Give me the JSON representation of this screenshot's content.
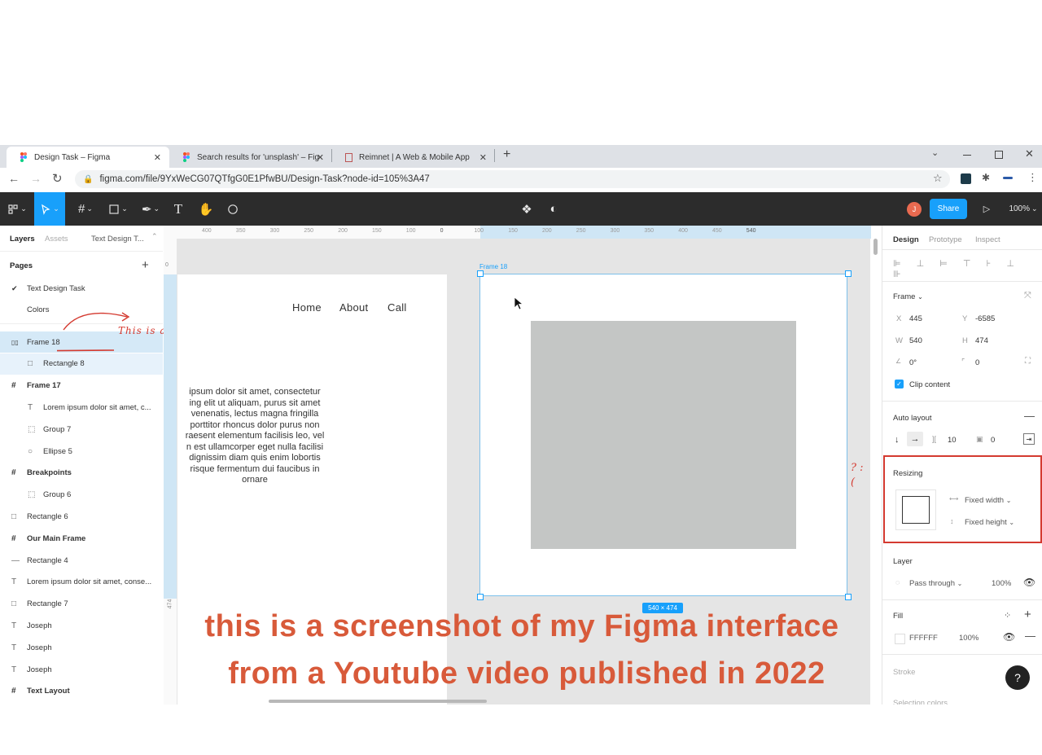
{
  "browser": {
    "tabs": [
      {
        "title": "Design Task – Figma"
      },
      {
        "title": "Search results for 'unsplash' – Fig"
      },
      {
        "title": "Reimnet | A Web & Mobile App"
      }
    ],
    "url": "figma.com/file/9YxWeCG07QTfgG0E1PfwBU/Design-Task?node-id=105%3A47"
  },
  "toolbar": {
    "share_label": "Share",
    "zoom": "100%",
    "avatar_initial": "J"
  },
  "left_panel": {
    "tabs": [
      "Layers",
      "Assets",
      "Text Design T..."
    ],
    "pages_label": "Pages",
    "pages": [
      "Text Design Task",
      "Colors"
    ],
    "layers": [
      {
        "name": "Frame 18",
        "indent": 0,
        "icon": "auto-layout-icon",
        "selected": true
      },
      {
        "name": "Rectangle 8",
        "indent": 1,
        "icon": "rectangle-icon",
        "selected": true
      },
      {
        "name": "Frame 17",
        "indent": 0,
        "icon": "frame-icon",
        "selected": false
      },
      {
        "name": "Lorem ipsum dolor sit amet, c...",
        "indent": 1,
        "icon": "text-icon",
        "selected": false
      },
      {
        "name": "Group 7",
        "indent": 1,
        "icon": "group-icon",
        "selected": false
      },
      {
        "name": "Ellipse 5",
        "indent": 1,
        "icon": "ellipse-icon",
        "selected": false
      },
      {
        "name": "Breakpoints",
        "indent": 0,
        "icon": "frame-icon",
        "selected": false
      },
      {
        "name": "Group 6",
        "indent": 1,
        "icon": "group-icon",
        "selected": false
      },
      {
        "name": "Rectangle 6",
        "indent": 0,
        "icon": "rectangle-icon",
        "selected": false
      },
      {
        "name": "Our Main Frame",
        "indent": 0,
        "icon": "frame-icon",
        "selected": false
      },
      {
        "name": "Rectangle 4",
        "indent": 0,
        "icon": "line-icon",
        "selected": false
      },
      {
        "name": "Lorem ipsum dolor sit amet, conse...",
        "indent": 0,
        "icon": "text-icon",
        "selected": false
      },
      {
        "name": "Rectangle 7",
        "indent": 0,
        "icon": "rectangle-icon",
        "selected": false
      },
      {
        "name": "Joseph",
        "indent": 0,
        "icon": "text-icon",
        "selected": false
      },
      {
        "name": "Joseph",
        "indent": 0,
        "icon": "text-icon",
        "selected": false
      },
      {
        "name": "Joseph",
        "indent": 0,
        "icon": "text-icon",
        "selected": false
      },
      {
        "name": "Text Layout",
        "indent": 0,
        "icon": "frame-icon",
        "selected": false
      }
    ],
    "annotation": "This is auto layout"
  },
  "ruler": {
    "top_ticks": [
      "400",
      "350",
      "300",
      "250",
      "200",
      "150",
      "100",
      "0",
      "100",
      "150",
      "200",
      "250",
      "300",
      "350",
      "400",
      "450",
      "540"
    ],
    "left_ticks": [
      "0",
      "474"
    ]
  },
  "canvas": {
    "nav_links": [
      "Home",
      "About",
      "Call"
    ],
    "paragraph_lines": [
      "ipsum dolor sit amet, consectetur",
      "ing elit ut aliquam, purus sit amet",
      "venenatis, lectus magna fringilla",
      "porttitor rhoncus dolor purus non",
      "raesent elementum facilisis leo, vel",
      "n est ullamcorper eget nulla facilisi",
      "dignissim diam quis enim lobortis",
      "risque fermentum dui faucibus in",
      "ornare"
    ],
    "frame_label": "Frame 18",
    "size_badge": "540 × 474",
    "question_annotation": "? :("
  },
  "right_panel": {
    "tabs": [
      "Design",
      "Prototype",
      "Inspect"
    ],
    "frame_label": "Frame",
    "x_label": "X",
    "x_value": "445",
    "y_label": "Y",
    "y_value": "-6585",
    "w_label": "W",
    "w_value": "540",
    "h_label": "H",
    "h_value": "474",
    "rotation": "0°",
    "radius": "0",
    "clip_content": "Clip content",
    "auto_layout_label": "Auto layout",
    "spacing": "10",
    "padding": "0",
    "resizing_label": "Resizing",
    "fixed_width": "Fixed width",
    "fixed_height": "Fixed height",
    "layer_label": "Layer",
    "blend_mode": "Pass through",
    "layer_opacity": "100%",
    "fill_label": "Fill",
    "fill_hex": "FFFFFF",
    "fill_opacity": "100%",
    "stroke_label": "Stroke",
    "selection_colors_label": "Selection colors"
  },
  "caption": {
    "line1": "this is a screenshot of my Figma interface",
    "line2": "from a Youtube video  published in 2022"
  },
  "colors": {
    "accent": "#18a0fb",
    "annotation": "#d85a3a",
    "highlight_red": "#d43a30"
  }
}
